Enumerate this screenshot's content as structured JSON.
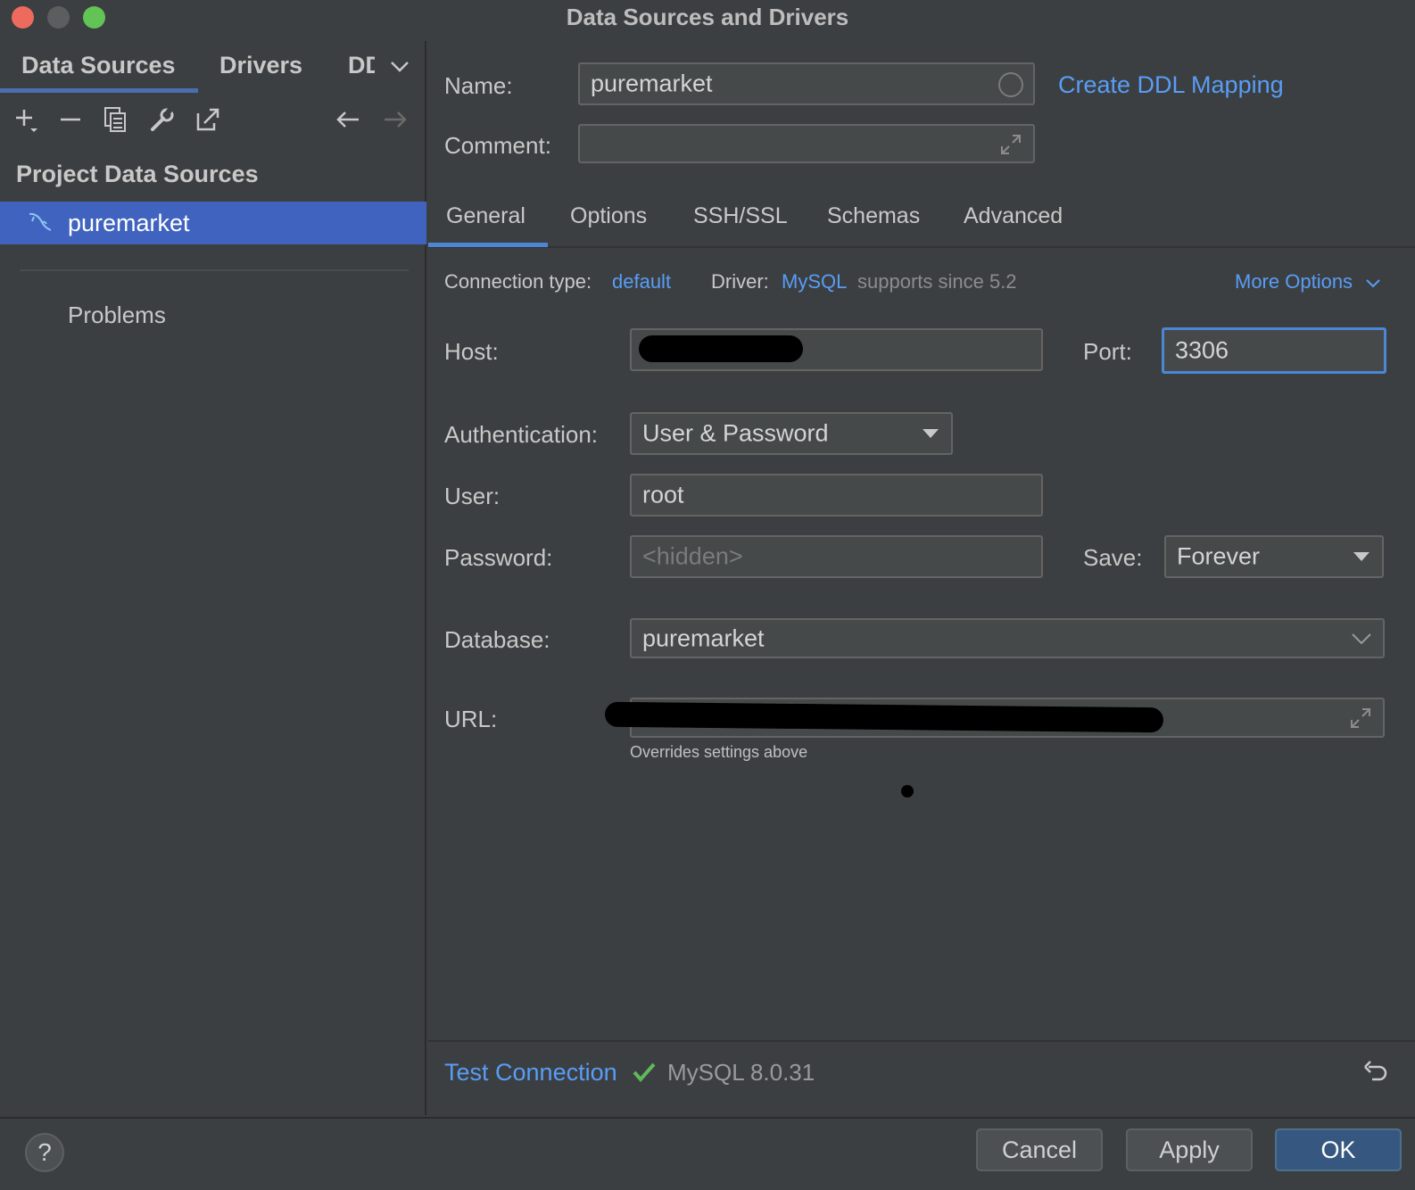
{
  "window": {
    "title": "Data Sources and Drivers"
  },
  "left_panel": {
    "tabs": [
      "Data Sources",
      "Drivers",
      "DDL"
    ],
    "section_title": "Project Data Sources",
    "selected_item": "puremarket",
    "problems_label": "Problems"
  },
  "form": {
    "name_label": "Name:",
    "name_value": "puremarket",
    "create_ddl_link": "Create DDL Mapping",
    "comment_label": "Comment:",
    "comment_value": ""
  },
  "tabs": [
    "General",
    "Options",
    "SSH/SSL",
    "Schemas",
    "Advanced"
  ],
  "general": {
    "connection_type_label": "Connection type:",
    "connection_type_value": "default",
    "driver_label": "Driver:",
    "driver_value": "MySQL",
    "driver_note": "supports since 5.2",
    "more_options": "More Options",
    "host_label": "Host:",
    "host_value": "",
    "port_label": "Port:",
    "port_value": "3306",
    "auth_label": "Authentication:",
    "auth_value": "User & Password",
    "user_label": "User:",
    "user_value": "root",
    "password_label": "Password:",
    "password_placeholder": "<hidden>",
    "save_label": "Save:",
    "save_value": "Forever",
    "database_label": "Database:",
    "database_value": "puremarket",
    "url_label": "URL:",
    "url_value": "",
    "url_hint": "Overrides settings above"
  },
  "status": {
    "test_connection": "Test Connection",
    "version": "MySQL 8.0.31"
  },
  "footer": {
    "help": "?",
    "cancel": "Cancel",
    "apply": "Apply",
    "ok": "OK"
  },
  "colors": {
    "background": "#3c3f41",
    "selection": "#4063bf",
    "link": "#589df6",
    "ok_button": "#365880",
    "success": "#5fb85a"
  }
}
